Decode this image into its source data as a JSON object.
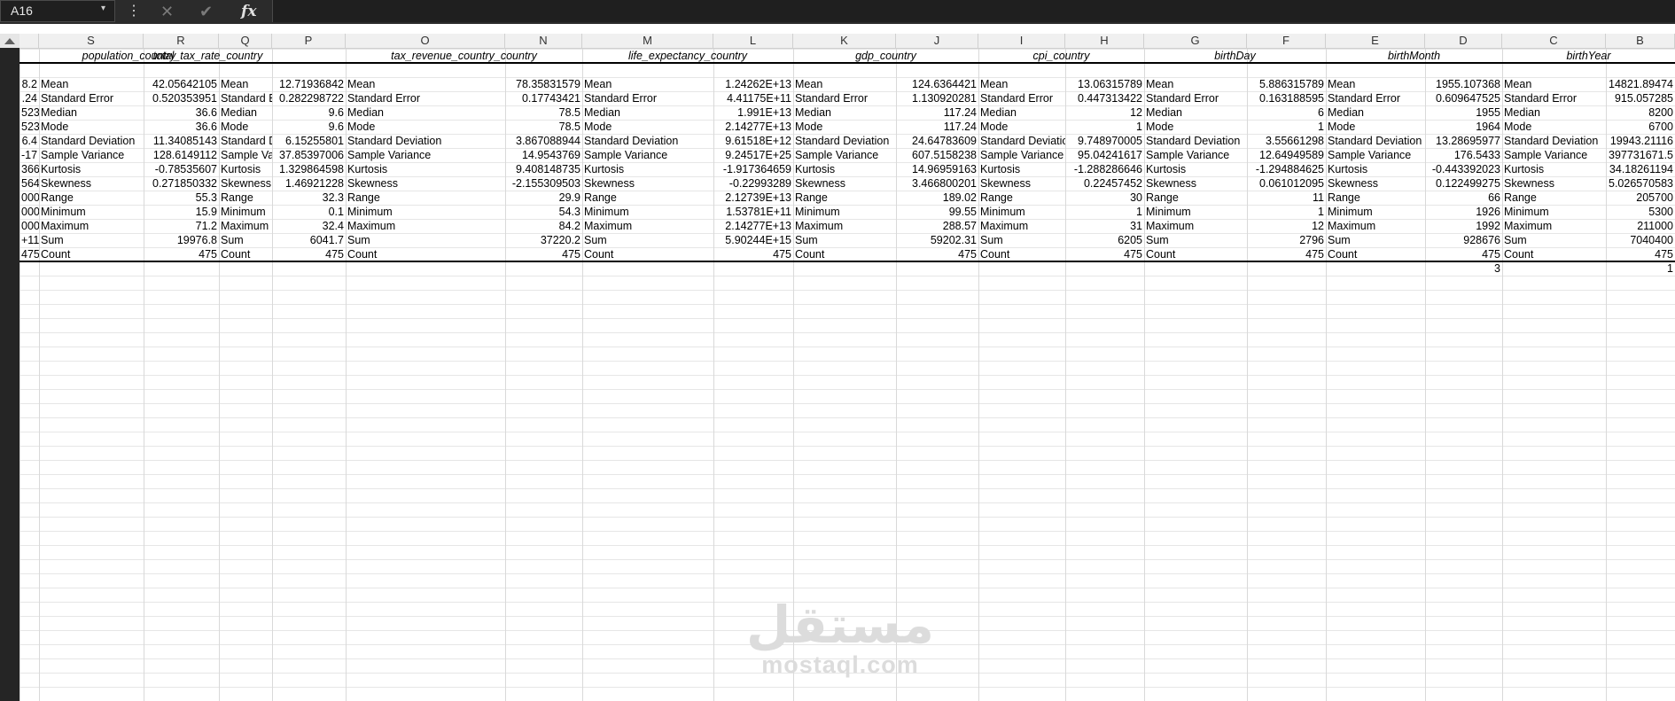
{
  "toolbar": {
    "name_box": "A16",
    "name_box_arrow": "▾",
    "kebab_glyph": "⋮",
    "cancel_glyph": "✕",
    "enter_glyph": "✔",
    "function_label": "fx",
    "formula": ""
  },
  "columns": [
    {
      "letter": "S",
      "header": "population_country",
      "label": "Mean",
      "stat_labels": [
        "Mean",
        "Standard Error",
        "Median",
        "Mode",
        "Standard Deviation",
        "Sample Variance",
        "Kurtosis",
        "Skewness",
        "Range",
        "Minimum",
        "Maximum",
        "Sum",
        "Count"
      ]
    },
    {
      "letter": "R",
      "header": "total_tax_rate_country",
      "label": "",
      "stat_values": [
        "42.05642105",
        "0.520353951",
        "36.6",
        "36.6",
        "11.34085143",
        "128.6149112",
        "-0.78535607",
        "0.271850332",
        "55.3",
        "15.9",
        "71.2",
        "19976.8",
        "475"
      ]
    },
    {
      "letter": "Q",
      "header": "",
      "label": "",
      "stat_labels": [
        "Mean",
        "Standard Error",
        "Median",
        "Mode",
        "Standard Deviation",
        "Sample Variance",
        "Kurtosis",
        "Skewness",
        "Range",
        "Minimum",
        "Maximum",
        "Sum",
        "Count"
      ]
    },
    {
      "letter": "P",
      "header": "",
      "stat_values": [
        "12.71936842",
        "0.282298722",
        "9.6",
        "9.6",
        "6.15255801",
        "37.85397006",
        "1.329864598",
        "1.46921228",
        "32.3",
        "0.1",
        "32.4",
        "6041.7",
        "475"
      ]
    },
    {
      "letter": "O",
      "header": "tax_revenue_country_country",
      "stat_labels": [
        "Mean",
        "Standard Error",
        "Median",
        "Mode",
        "Standard Deviation",
        "Sample Variance",
        "Kurtosis",
        "Skewness",
        "Range",
        "Minimum",
        "Maximum",
        "Sum",
        "Count"
      ]
    },
    {
      "letter": "N",
      "header": "",
      "stat_values": [
        "78.35831579",
        "0.17743421",
        "78.5",
        "78.5",
        "3.867088944",
        "14.9543769",
        "9.408148735",
        "-2.155309503",
        "29.9",
        "54.3",
        "84.2",
        "37220.2",
        "475"
      ]
    },
    {
      "letter": "M",
      "header": "life_expectancy_country",
      "stat_labels": [
        "Mean",
        "Standard Error",
        "Median",
        "Mode",
        "Standard Deviation",
        "Sample Variance",
        "Kurtosis",
        "Skewness",
        "Range",
        "Minimum",
        "Maximum",
        "Sum",
        "Count"
      ]
    },
    {
      "letter": "L",
      "header": "",
      "stat_values": [
        "1.24262E+13",
        "4.41175E+11",
        "1.991E+13",
        "2.14277E+13",
        "9.61518E+12",
        "9.24517E+25",
        "-1.917364659",
        "-0.22993289",
        "2.12739E+13",
        "1.53781E+11",
        "2.14277E+13",
        "5.90244E+15",
        "475"
      ]
    },
    {
      "letter": "K",
      "header": "gdp_country",
      "stat_labels": [
        "Mean",
        "Standard Error",
        "Median",
        "Mode",
        "Standard Deviation",
        "Sample Variance",
        "Kurtosis",
        "Skewness",
        "Range",
        "Minimum",
        "Maximum",
        "Sum",
        "Count"
      ]
    },
    {
      "letter": "J",
      "header": "",
      "stat_values": [
        "124.6364421",
        "1.130920281",
        "117.24",
        "117.24",
        "24.64783609",
        "607.5158238",
        "14.96959163",
        "3.466800201",
        "189.02",
        "99.55",
        "288.57",
        "59202.31",
        "475"
      ]
    },
    {
      "letter": "I",
      "header": "cpi_country",
      "stat_labels": [
        "Mean",
        "Standard Error",
        "Median",
        "Mode",
        "Standard Deviation",
        "Sample Variance",
        "Kurtosis",
        "Skewness",
        "Range",
        "Minimum",
        "Maximum",
        "Sum",
        "Count"
      ]
    },
    {
      "letter": "H",
      "header": "",
      "stat_values": [
        "13.06315789",
        "0.447313422",
        "12",
        "1",
        "9.748970005",
        "95.04241617",
        "-1.288286646",
        "0.22457452",
        "30",
        "1",
        "31",
        "6205",
        "475"
      ]
    },
    {
      "letter": "G",
      "header": "birthDay",
      "stat_labels": [
        "Mean",
        "Standard Error",
        "Median",
        "Mode",
        "Standard Deviation",
        "Sample Variance",
        "Kurtosis",
        "Skewness",
        "Range",
        "Minimum",
        "Maximum",
        "Sum",
        "Count"
      ]
    },
    {
      "letter": "F",
      "header": "",
      "stat_values": [
        "5.886315789",
        "0.163188595",
        "6",
        "1",
        "3.55661298",
        "12.64949589",
        "-1.294884625",
        "0.061012095",
        "11",
        "1",
        "12",
        "2796",
        "475"
      ]
    },
    {
      "letter": "E",
      "header": "birthMonth",
      "stat_labels": [
        "Mean",
        "Standard Error",
        "Median",
        "Mode",
        "Standard Deviation",
        "Sample Variance",
        "Kurtosis",
        "Skewness",
        "Range",
        "Minimum",
        "Maximum",
        "Sum",
        "Count"
      ]
    },
    {
      "letter": "D",
      "header": "",
      "stat_values": [
        "1955.107368",
        "0.609647525",
        "1955",
        "1964",
        "13.28695977",
        "176.5433",
        "-0.443392023",
        "0.122499275",
        "66",
        "1926",
        "1992",
        "928676",
        "475"
      ],
      "extra": "3"
    },
    {
      "letter": "C",
      "header": "birthYear",
      "stat_labels": [
        "Mean",
        "Standard Error",
        "Median",
        "Mode",
        "Standard Deviation",
        "Sample Variance",
        "Kurtosis",
        "Skewness",
        "Range",
        "Minimum",
        "Maximum",
        "Sum",
        "Count"
      ]
    },
    {
      "letter": "B",
      "header": "",
      "stat_values": [
        "14821.89474",
        "915.057285",
        "8200",
        "6700",
        "19943.21116",
        "397731671.5",
        "34.18261194",
        "5.026570583",
        "205700",
        "5300",
        "211000",
        "7040400",
        "475"
      ],
      "extra": "1"
    }
  ],
  "left_clipped_values": [
    "8.2",
    ".24",
    "523",
    "523",
    "6.4",
    "-17",
    "366",
    "564",
    "000",
    "000",
    "000",
    "+11",
    "475"
  ],
  "watermark": {
    "arabic": "مستقل",
    "latin": "mostaql.com"
  }
}
